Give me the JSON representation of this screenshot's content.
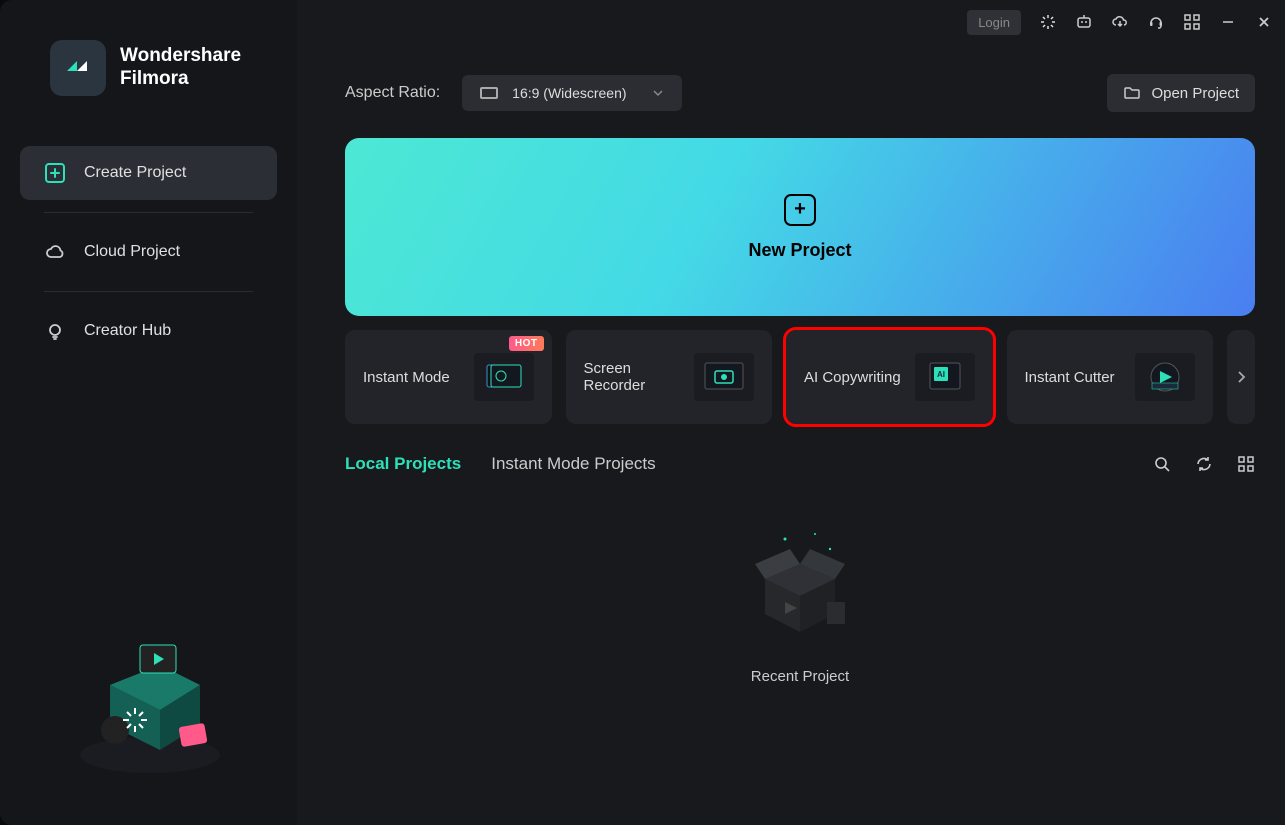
{
  "app": {
    "name_line1": "Wondershare",
    "name_line2": "Filmora"
  },
  "titlebar": {
    "login": "Login"
  },
  "sidebar": {
    "items": [
      {
        "label": "Create Project"
      },
      {
        "label": "Cloud Project"
      },
      {
        "label": "Creator Hub"
      }
    ]
  },
  "aspect_ratio": {
    "label": "Aspect Ratio:",
    "value": "16:9 (Widescreen)"
  },
  "open_project": "Open Project",
  "new_project": "New Project",
  "cards": [
    {
      "label": "Instant Mode",
      "badge": "HOT"
    },
    {
      "label": "Screen Recorder"
    },
    {
      "label": "AI Copywriting"
    },
    {
      "label": "Instant Cutter"
    }
  ],
  "tabs": [
    {
      "label": "Local Projects",
      "active": true
    },
    {
      "label": "Instant Mode Projects",
      "active": false
    }
  ],
  "empty_caption": "Recent Project"
}
